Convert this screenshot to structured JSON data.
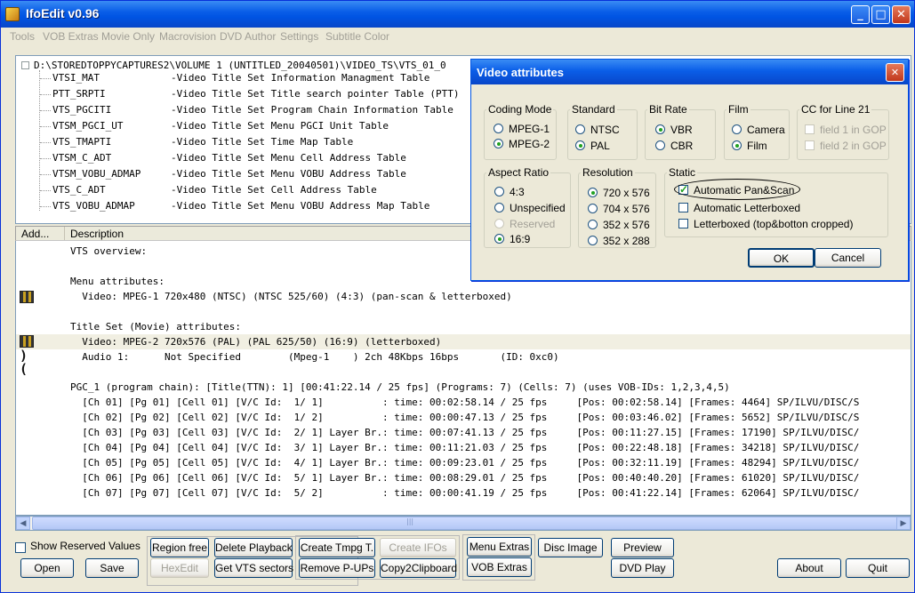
{
  "window": {
    "title": "IfoEdit v0.96",
    "min": "_",
    "max": "□",
    "close": "✕"
  },
  "menu": [
    "Tools",
    "VOB Extras",
    "Movie Only",
    "Macrovision",
    "DVD Author",
    "Settings",
    "Subtitle Color"
  ],
  "tree": {
    "root": "D:\\STOREDTOPPYCAPTURES2\\VOLUME 1 (UNTITLED_20040501)\\VIDEO_TS\\VTS_01_0",
    "items": [
      {
        "name": "VTSI_MAT",
        "desc": "-Video Title Set Information Managment Table"
      },
      {
        "name": "PTT_SRPTI",
        "desc": "-Video Title Set Title search pointer Table (PTT)"
      },
      {
        "name": "VTS_PGCITI",
        "desc": "-Video Title Set Program Chain Information Table"
      },
      {
        "name": "VTSM_PGCI_UT",
        "desc": "-Video Title Set Menu PGCI Unit Table"
      },
      {
        "name": "VTS_TMAPTI",
        "desc": "-Video Title Set Time Map Table"
      },
      {
        "name": "VTSM_C_ADT",
        "desc": "-Video Title Set Menu Cell Address Table"
      },
      {
        "name": "VTSM_VOBU_ADMAP",
        "desc": "-Video Title Set Menu VOBU Address Table"
      },
      {
        "name": "VTS_C_ADT",
        "desc": "-Video Title Set Cell Address Table"
      },
      {
        "name": "VTS_VOBU_ADMAP",
        "desc": "-Video Title Set Menu VOBU Address Map Table"
      }
    ]
  },
  "list": {
    "headers": [
      "Add...",
      "Description"
    ],
    "rows": [
      "VTS overview:",
      "",
      "Menu attributes:",
      "  Video: MPEG-1 720x480 (NTSC) (NTSC 525/60) (4:3) (pan-scan & letterboxed)",
      "",
      "Title Set (Movie) attributes:",
      "  Video: MPEG-2 720x576 (PAL) (PAL 625/50) (16:9) (letterboxed)",
      "  Audio 1:      Not Specified        (Mpeg-1    ) 2ch 48Kbps 16bps       (ID: 0xc0)",
      "",
      "PGC_1 (program chain): [Title(TTN): 1] [00:41:22.14 / 25 fps] (Programs: 7) (Cells: 7) (uses VOB-IDs: 1,2,3,4,5)",
      "  [Ch 01] [Pg 01] [Cell 01] [V/C Id:  1/ 1]          : time: 00:02:58.14 / 25 fps     [Pos: 00:02:58.14] [Frames: 4464] SP/ILVU/DISC/S",
      "  [Ch 02] [Pg 02] [Cell 02] [V/C Id:  1/ 2]          : time: 00:00:47.13 / 25 fps     [Pos: 00:03:46.02] [Frames: 5652] SP/ILVU/DISC/S",
      "  [Ch 03] [Pg 03] [Cell 03] [V/C Id:  2/ 1] Layer Br.: time: 00:07:41.13 / 25 fps     [Pos: 00:11:27.15] [Frames: 17190] SP/ILVU/DISC/",
      "  [Ch 04] [Pg 04] [Cell 04] [V/C Id:  3/ 1] Layer Br.: time: 00:11:21.03 / 25 fps     [Pos: 00:22:48.18] [Frames: 34218] SP/ILVU/DISC/",
      "  [Ch 05] [Pg 05] [Cell 05] [V/C Id:  4/ 1] Layer Br.: time: 00:09:23.01 / 25 fps     [Pos: 00:32:11.19] [Frames: 48294] SP/ILVU/DISC/",
      "  [Ch 06] [Pg 06] [Cell 06] [V/C Id:  5/ 1] Layer Br.: time: 00:08:29.01 / 25 fps     [Pos: 00:40:40.20] [Frames: 61020] SP/ILVU/DISC/",
      "  [Ch 07] [Pg 07] [Cell 07] [V/C Id:  5/ 2]          : time: 00:00:41.19 / 25 fps     [Pos: 00:41:22.14] [Frames: 62064] SP/ILVU/DISC/"
    ]
  },
  "scroll": {
    "left": "◀",
    "right": "▶",
    "grip": "|||"
  },
  "bottom": {
    "show_reserved": "Show Reserved Values",
    "open": "Open",
    "save": "Save",
    "region_free": "Region free",
    "hexedit": "HexEdit",
    "delete_playback": "Delete Playback",
    "get_vts_sectors": "Get VTS sectors",
    "create_tmpg": "Create Tmpg T.",
    "remove_pups": "Remove P-UPs",
    "create_ifos": "Create IFOs",
    "copy2clipboard": "Copy2Clipboard",
    "menu_extras": "Menu Extras",
    "vob_extras": "VOB Extras",
    "disc_image": "Disc Image",
    "preview": "Preview",
    "dvd_play": "DVD Play",
    "about": "About",
    "quit": "Quit"
  },
  "dialog": {
    "title": "Video attributes",
    "close": "✕",
    "coding_mode": {
      "legend": "Coding Mode",
      "options": [
        "MPEG-1",
        "MPEG-2"
      ],
      "selected": "MPEG-2"
    },
    "standard": {
      "legend": "Standard",
      "options": [
        "NTSC",
        "PAL"
      ],
      "selected": "PAL"
    },
    "bit_rate": {
      "legend": "Bit Rate",
      "options": [
        "VBR",
        "CBR"
      ],
      "selected": "VBR"
    },
    "film": {
      "legend": "Film",
      "options": [
        "Camera",
        "Film"
      ],
      "selected": "Film"
    },
    "cc": {
      "legend": "CC for Line 21",
      "options": [
        "field 1 in GOP",
        "field 2 in GOP"
      ]
    },
    "aspect": {
      "legend": "Aspect Ratio",
      "options": [
        "4:3",
        "Unspecified",
        "Reserved",
        "16:9"
      ],
      "selected": "16:9"
    },
    "resolution": {
      "legend": "Resolution",
      "options": [
        "720 x  576",
        "704 x  576",
        "352 x  576",
        "352 x  288"
      ],
      "selected": "720 x  576"
    },
    "static": {
      "legend": "Static",
      "options": [
        "Automatic Pan&Scan",
        "Automatic Letterboxed",
        "Letterboxed (top&botton cropped)"
      ],
      "checked": "Automatic Pan&Scan"
    },
    "ok": "OK",
    "cancel": "Cancel"
  }
}
